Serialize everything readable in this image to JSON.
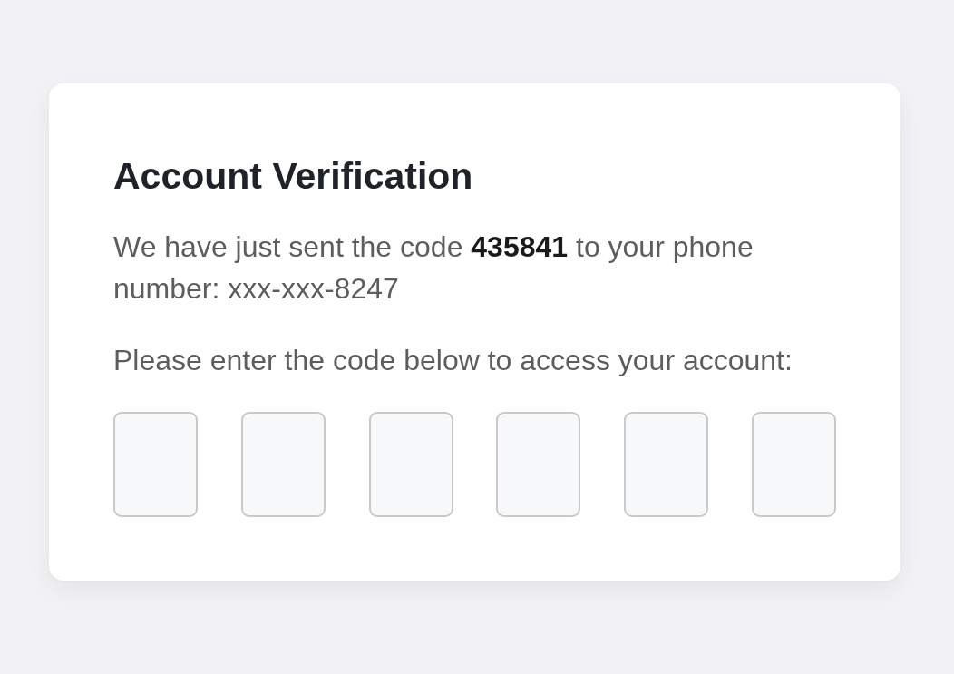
{
  "card": {
    "title": "Account Verification",
    "message": "We have just sent the code **435841** to your phone number: xxx-xxx-8247",
    "instruction": "Please enter the code below to access your account:",
    "code_inputs": [
      {
        "kind": "digit"
      },
      {
        "kind": "digit"
      },
      {
        "kind": "digit"
      },
      {
        "kind": "digit"
      },
      {
        "kind": "digit"
      },
      {
        "kind": "digit"
      }
    ]
  }
}
